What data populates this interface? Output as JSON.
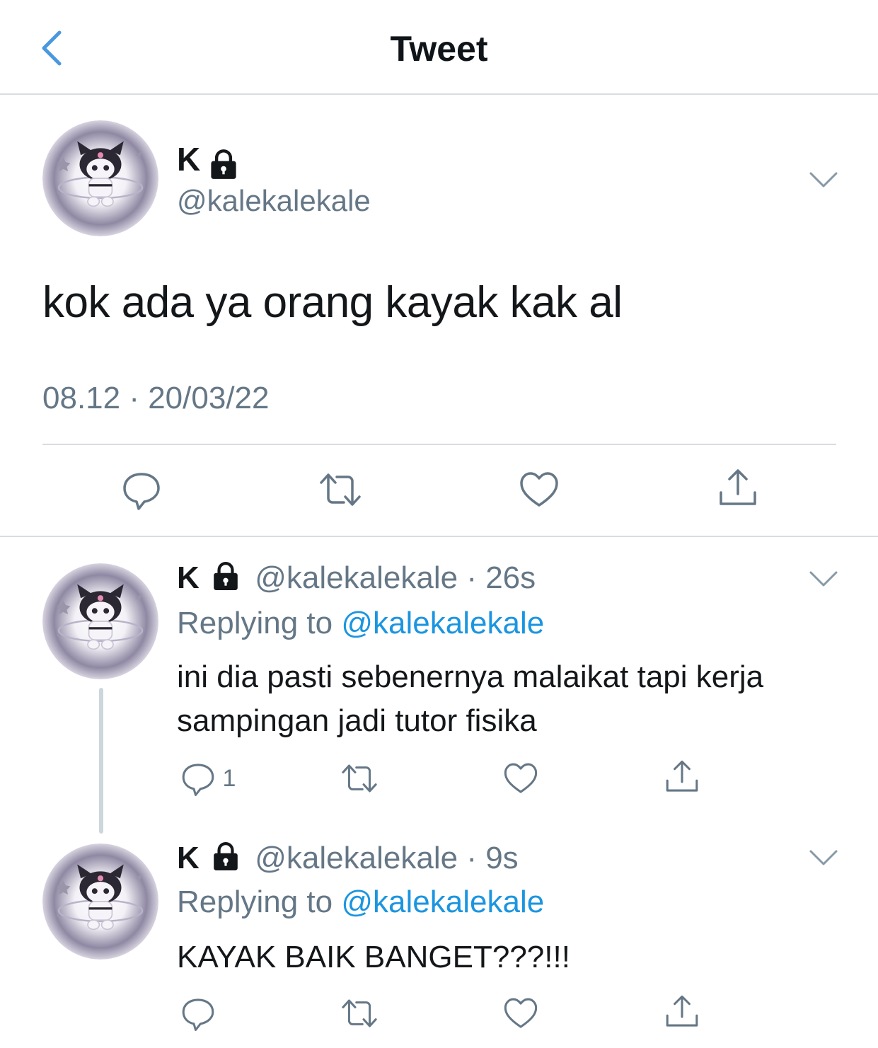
{
  "header": {
    "title": "Tweet",
    "back_icon": "chevron-left-icon"
  },
  "colors": {
    "accent": "#1b95e0",
    "secondary": "#657786",
    "text": "#14171a",
    "divider": "#d9dde1"
  },
  "main_tweet": {
    "name": "K",
    "handle": "@kalekalekale",
    "text": "kok ada ya orang kayak kak al",
    "timestamp": "08.12 · 20/03/22",
    "actions": [
      "reply-icon",
      "retweet-icon",
      "like-icon",
      "share-icon"
    ]
  },
  "replies": [
    {
      "name": "K",
      "handle": "@kalekalekale",
      "time": "· 26s",
      "replying_label": "Replying to",
      "replying_to": "@kalekalekale",
      "text": "ini dia pasti sebenernya malaikat tapi kerja sampingan jadi tutor fisika",
      "reply_count": "1"
    },
    {
      "name": "K",
      "handle": "@kalekalekale",
      "time": "· 9s",
      "replying_label": "Replying to",
      "replying_to": "@kalekalekale",
      "text": "KAYAK BAIK BANGET???!!!",
      "reply_count": ""
    }
  ]
}
